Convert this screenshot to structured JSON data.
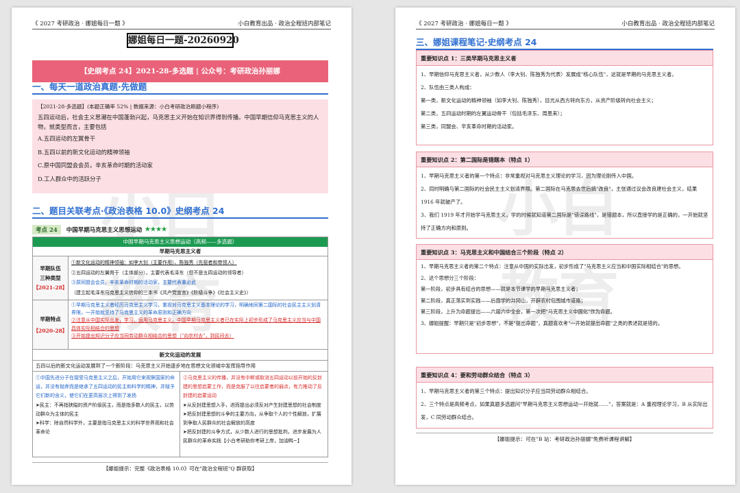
{
  "left": {
    "header_left": "《 2027 考研政治 · 娜姐每日一题 》",
    "header_right": "小白教育出品 · 政治全程班内部笔记",
    "title": "娜姐每日一题-20260920",
    "banner": "【史纲考点 24】2021-28-多选题 | 公众号：考研政治孙丽娜",
    "sec1": "一、每天一道政治真题·先做题",
    "q_meta": "【2021-28-多选题】(本题正确率 52% | 数据来源：小白考研政治刷题小程序)",
    "q_stem": "五四运动后，社会主义思潮在中国蓬勃兴起，马克思主义开始在知识界得到传播。中国早期信仰马克思主义的人物，就类型而言，主要包括",
    "options": [
      "A.五四运动的左翼骨干",
      "B.五四以前的新文化运动的精神领袖",
      "C.原中国同盟会会员，辛亥革命时期的活动家",
      "D.工人群众中的活跃分子"
    ],
    "sec2": "二、题目关联考点·《政治表格 10.0》史纲考点 24",
    "kp_tag": "考点 24",
    "kp_title": "中国早期马克思主义思想运动",
    "kp_stars": "★★★★",
    "table_head": "中国早期马克思主义思想运动（高频——多选题）",
    "sub1": "早期马克思主义者",
    "row1_label1": "早期队伍",
    "row1_label2": "三种类型",
    "row1_year": "【2021-28】",
    "row1_lines": [
      "①新文化运动的精神领袖：如李大钊（主要作用）、陈独秀（先驱者和带领人）",
      "②五四运动的左翼骨干（主体部分），主要代表毛泽东（但不是五四运动的领导者）",
      "③原同盟会会员、辛亥革命时期的活动家，主要代表董必武",
      "（建立起毛泽东马克思主义信仰的三本书《共产党宣言》《阶级斗争》《社会主义史》）"
    ],
    "row2_label": "早期特点",
    "row2_year": "【2020-28】",
    "row2_lines": [
      "①早期马克思主义者经历马克思主义学习，重视对马克思主义基本理论的学习，明确地同第二国际的社会民主主义划清界限，一开始就坚持了马克思主义的革命原则和正确方向",
      "②注意从中国实际出发，学习、运用马克思主义，中国早期马克思主义者已在实际上初步形成了马克思主义应当与中国具体实际相结合的思想",
      "③开始提出知识分子应当同劳动群众相结合的思想（\"向农村去\"，到民间去）"
    ],
    "sub2": "新文化运动的发展",
    "dev_intro": "五四以后的新文化运动发展到了一个新阶段：马克思主义开始逐步地在思想文化领域中发挥指导作用",
    "dev_left": [
      "①中国先进分子在接受马克思主义之后，开始用它来观察国家的命运，并没有抛弃而是继承了五四运动的民主和科学的精神，并赋予它们新的含义，使它们在更高层次上得到了发扬",
      "➤民主：不再指狭隘的资产阶级民主，而是指多数人的民主，以劳动群众为主体的民主",
      "➤科学：除自然科学外，主要是指马克思主义的科学世界观和社会革命论"
    ],
    "dev_right": [
      "②马克思主义的传播，并没有中断或取消五四运动以前开始的反封建的思想启蒙工作，而是克服了以往启蒙者的弱点，有力推动了反封建的启蒙运动",
      "➤从反封建思想入手，进而提出必须反对产生封建思想的社会制度",
      "➤把反封建思想的斗争的主要方向，从争取个人的个性解放，扩展到争取人民群众的社会解放的高度",
      "➤把反封建的斗争方式，从少数人进行的思想批判，进步发展为人民群众的革命实践【小白考研助你考研上岸，加油鸭~】"
    ],
    "footer": "【娜姐提示：完整《政治表格 10.0》可在\"政治全程班\"Q 群获取】",
    "wm1": "小白",
    "wm2": "教育"
  },
  "right": {
    "header_left": "《 2027 考研政治 · 娜姐每日一题 》",
    "header_right": "小白教育出品 · 政治全程班内部笔记",
    "sec3": "三、娜姐课程笔记·史纲考点 24",
    "box1_title": "重要知识点 1：三类早期马克思主义者",
    "box1_lines": [
      "1、早期信仰马克思主义者，从少数人（李大钊、陈独秀为代表）发展成\"核心队伍\"，这就是早期的马克思主义者。",
      "2、队伍由三类人构成：",
      "第一类，新文化运动的精神领袖（如李大钊、陈独秀），目光从西方转向东方，从资产阶级转向社会主义；",
      "第二类，五四运动时期的左翼运动骨干（包括毛泽东、周恩来）；",
      "第三类，同盟会、辛亥革命时期的活动家。"
    ],
    "box2_title": "重要知识点 2：第二国际是错题本（特点 1）",
    "box2_lines": [
      "1、早期马克思主义者的第一个特点：非常重视对马克思主义理论的学习，因为理论刚传入中国。",
      "2、同时明确与第二国际的社会民主主义划清界限。第二国际在马克思去世后搞\"改良\"，主张通过议会改良建社会主义，结果 1916 年就破产了。",
      "3、我们 1919 年才开始学马克思主义，学的时候就知道第二国际是\"错误路线\"，是错题本，所以直接学的是正确的，一开始就坚持了正确方向和原则。"
    ],
    "box3_title": "重要知识点 3：马克思主义和中国结合三个阶段（特点 2）",
    "box3_lines": [
      "1、早期马克思主义者的第二个特点：注意从中国的实际出发，初步形成了\"马克思主义应当和中国实际相结合\"的思想。",
      "2、这个思想分三个阶段：",
      "第一阶段，初步具有结合的思想——就是本节课学的早期马克思主义者；",
      "第二阶段，真正落实到实践——后面学的井冈山，开辟农村包围城市道路；",
      "第三阶段，上升为命题提出——六届六中全会，第一次把\"马克思主义中国化\"作为命题。",
      "3、娜姐提醒：早期只是\"初步思想\"，不是\"提出命题\"，真题喜欢考\"一开始就提出命题\"之类的表述就是错的。"
    ],
    "box4_title": "重要知识点 4：要和劳动群众结合（特点 3）",
    "box4_lines": [
      "1、早期马克思主义者的第三个特点：提出知识分子应当同劳动群众相结合。",
      "2、三个特点是高频考点，如果真题多选题问\"早期马克思主义思想运动一开始就……\"，答案就是：A 重视理论学习，B 从实际出发，C 同劳动群众结合。"
    ],
    "footer": "【娜姐提示：可在\"B 站：考研政治孙丽娜\"免费听课程讲解】",
    "wm1": "小白",
    "wm2": "教育"
  }
}
